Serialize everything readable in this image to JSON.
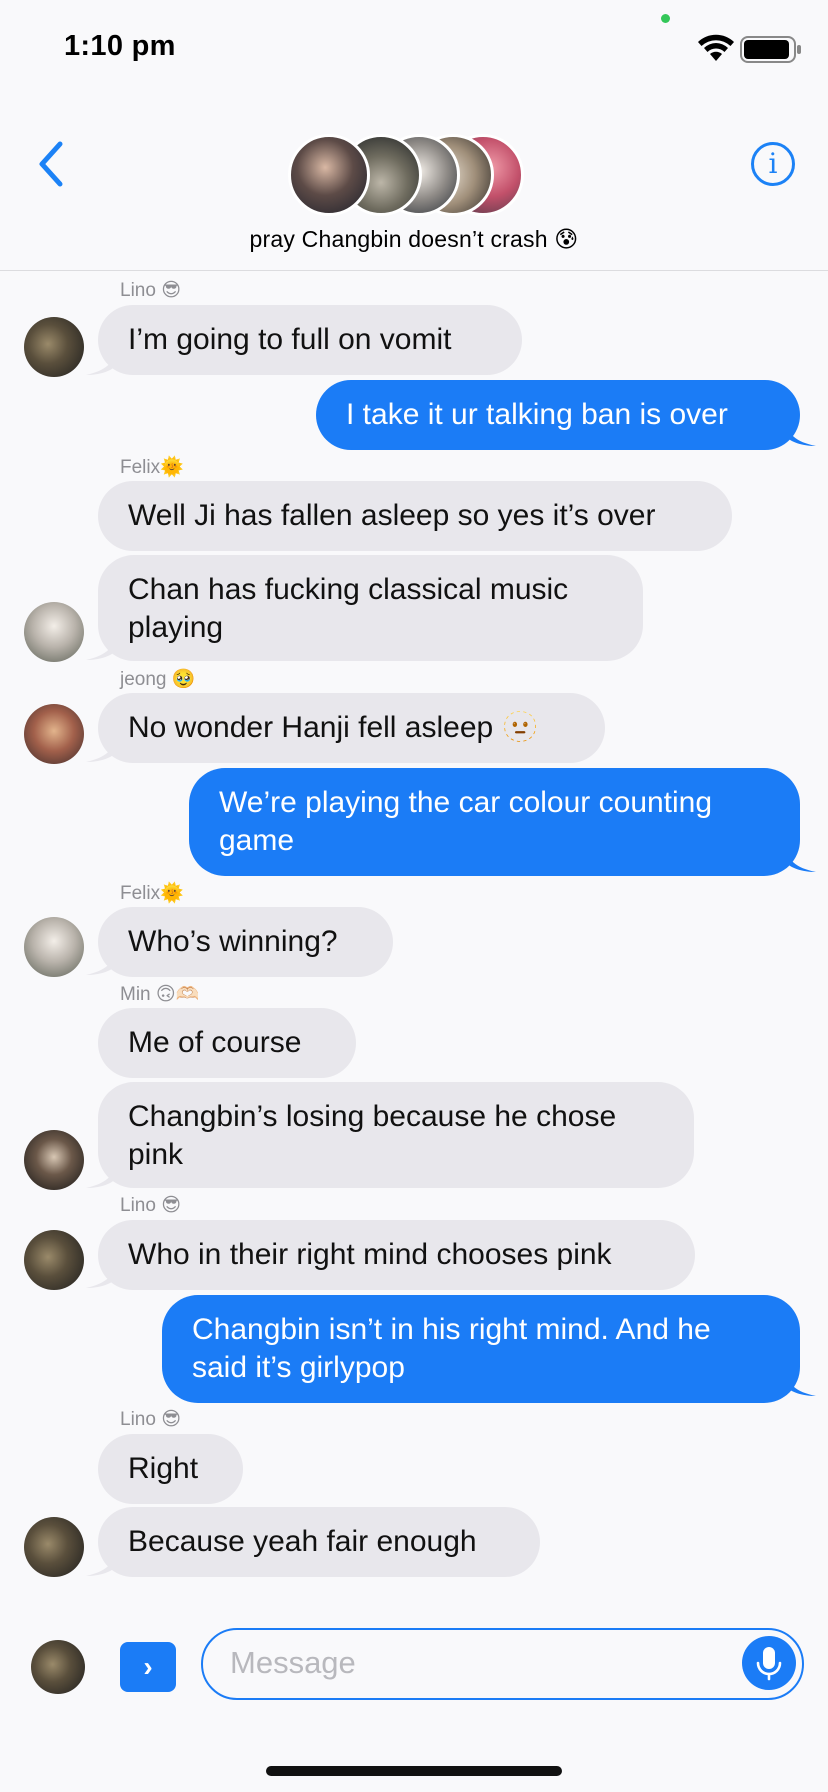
{
  "status_bar": {
    "time": "1:10 pm"
  },
  "header": {
    "group_title": "pray Changbin doesn’t crash 😰",
    "info_glyph": "i",
    "back_icon": "chevron-left-icon",
    "info_icon": "info-icon"
  },
  "messages": [
    {
      "sender": "Lino 😎",
      "text": "I’m going to full on vomit",
      "side": "in"
    },
    {
      "text": "I take it ur talking ban is over",
      "side": "out"
    },
    {
      "sender": "Felix🌞",
      "text": "Well Ji has fallen asleep so yes it’s over",
      "side": "in"
    },
    {
      "text": "Chan has fucking classical music playing",
      "line1": "Chan has fucking classical music",
      "line2": "playing",
      "side": "in"
    },
    {
      "sender": "jeong 🥹",
      "text": "No wonder Hanji fell asleep 🫥",
      "side": "in"
    },
    {
      "text": "We’re playing the car colour counting game",
      "line1": "We’re playing the car colour counting",
      "line2": "game",
      "side": "out"
    },
    {
      "sender": "Felix🌞",
      "text": "Who’s winning?",
      "side": "in"
    },
    {
      "sender": "Min 🙃🫶🏻",
      "text": "Me of course",
      "side": "in"
    },
    {
      "text": "Changbin’s losing because he chose pink",
      "line1": "Changbin’s losing because he chose",
      "line2": "pink",
      "side": "in"
    },
    {
      "sender": "Lino 😎",
      "text": "Who in their right mind chooses pink",
      "side": "in"
    },
    {
      "text": "Changbin isn’t in his right mind. And he said it’s girlypop",
      "line1": "Changbin isn’t in his right mind. And he",
      "line2": "said it’s girlypop",
      "side": "out"
    },
    {
      "sender": "Lino 😎",
      "text": "Right",
      "side": "in"
    },
    {
      "text": "Because yeah fair enough",
      "side": "in"
    }
  ],
  "input": {
    "placeholder": "Message",
    "apps_glyph": "›",
    "mic_icon": "microphone-icon"
  },
  "colors": {
    "accent": "#1b7cf6",
    "incoming_bubble": "#e8e7ec",
    "online_dot": "#34c759"
  }
}
